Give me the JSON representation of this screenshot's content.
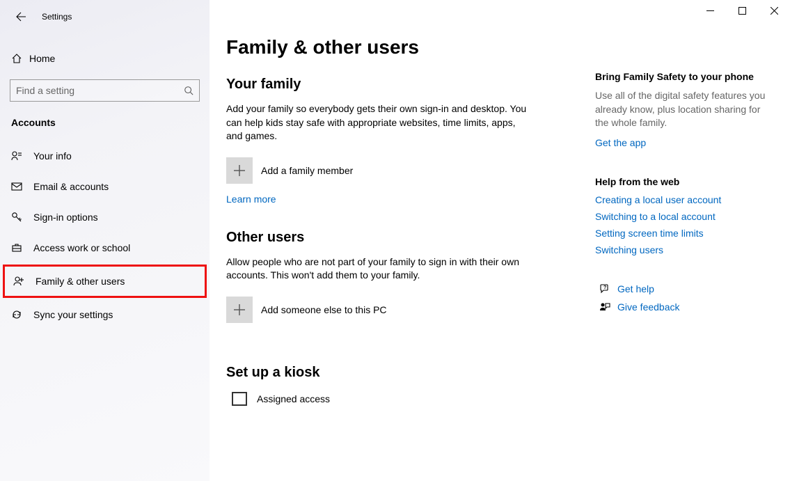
{
  "app_title": "Settings",
  "sidebar": {
    "home": "Home",
    "search_placeholder": "Find a setting",
    "section": "Accounts",
    "items": [
      {
        "label": "Your info"
      },
      {
        "label": "Email & accounts"
      },
      {
        "label": "Sign-in options"
      },
      {
        "label": "Access work or school"
      },
      {
        "label": "Family & other users"
      },
      {
        "label": "Sync your settings"
      }
    ]
  },
  "page": {
    "title": "Family & other users",
    "family": {
      "heading": "Your family",
      "desc": "Add your family so everybody gets their own sign-in and desktop. You can help kids stay safe with appropriate websites, time limits, apps, and games.",
      "add_label": "Add a family member",
      "learn_more": "Learn more"
    },
    "other": {
      "heading": "Other users",
      "desc": "Allow people who are not part of your family to sign in with their own accounts. This won't add them to your family.",
      "add_label": "Add someone else to this PC"
    },
    "kiosk": {
      "heading": "Set up a kiosk",
      "assigned": "Assigned access"
    }
  },
  "aside": {
    "safety": {
      "title": "Bring Family Safety to your phone",
      "desc": "Use all of the digital safety features you already know, plus location sharing for the whole family.",
      "cta": "Get the app"
    },
    "webhelp": {
      "title": "Help from the web",
      "links": [
        "Creating a local user account",
        "Switching to a local account",
        "Setting screen time limits",
        "Switching users"
      ]
    },
    "support": {
      "help": "Get help",
      "feedback": "Give feedback"
    }
  }
}
